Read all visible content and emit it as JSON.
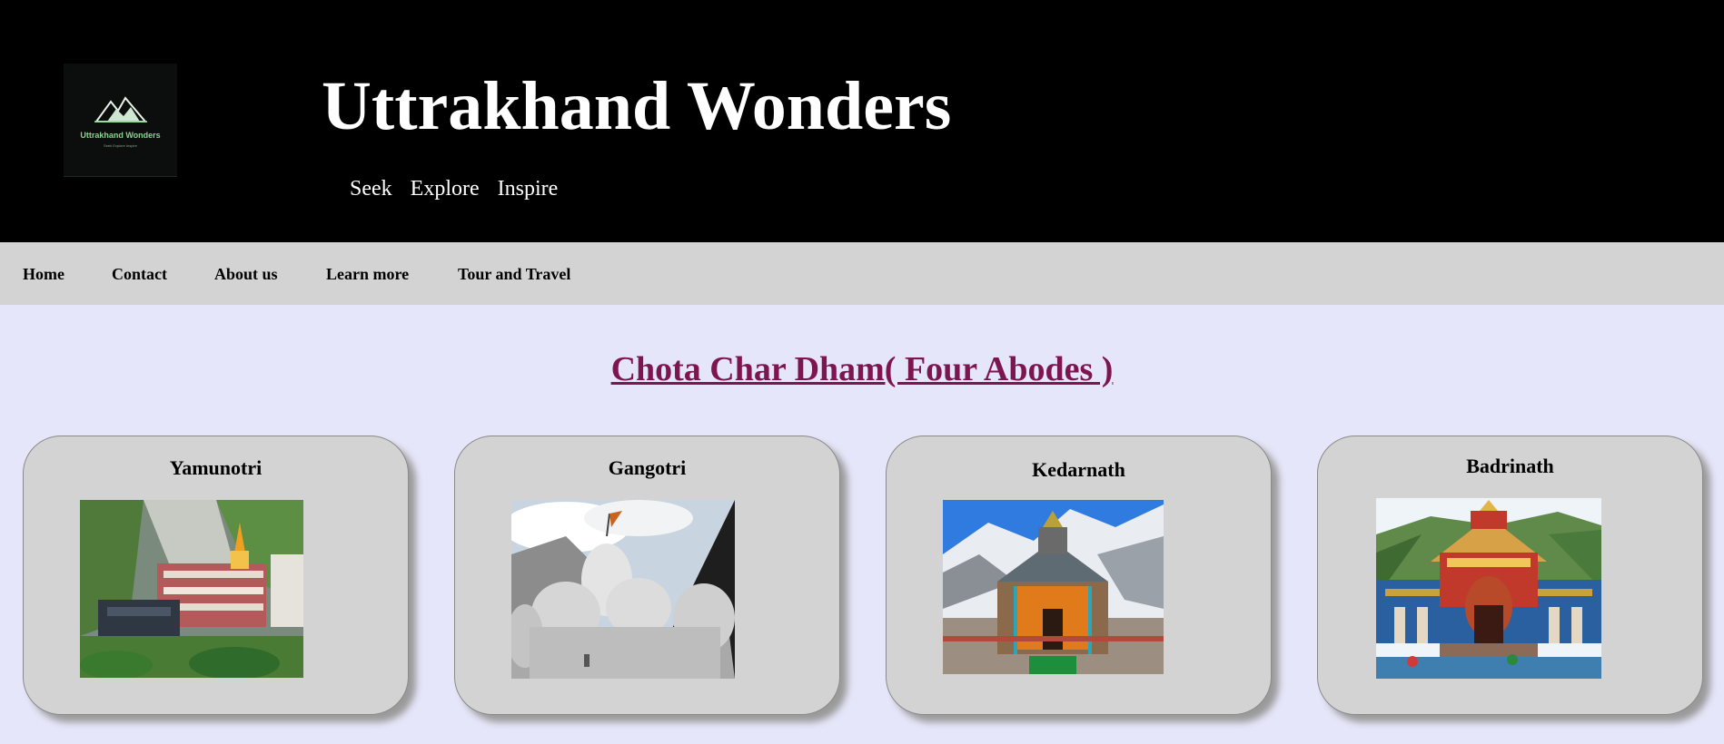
{
  "header": {
    "logo": {
      "name": "Uttrakhand Wonders",
      "tagline": "Seek Explore Inspire",
      "icon": "mountain-logo-icon"
    },
    "title": "Uttrakhand Wonders",
    "tagline_words": [
      "Seek",
      "Explore",
      "Inspire"
    ]
  },
  "nav": {
    "items": [
      "Home",
      "Contact",
      "About us",
      "Learn more",
      "Tour and Travel"
    ]
  },
  "section": {
    "title": "Chota Char Dham( Four Abodes )"
  },
  "cards": [
    {
      "title": "Yamunotri",
      "image": "yamunotri-temple-photo"
    },
    {
      "title": "Gangotri",
      "image": "gangotri-temple-photo"
    },
    {
      "title": "Kedarnath",
      "image": "kedarnath-temple-photo"
    },
    {
      "title": "Badrinath",
      "image": "badrinath-temple-photo"
    }
  ],
  "colors": {
    "header_bg": "#000000",
    "nav_bg": "#d3d3d3",
    "page_bg": "#e6e6fa",
    "section_title": "#7d1550",
    "card_bg": "#d3d3d3",
    "logo_text": "#7fd88a"
  }
}
